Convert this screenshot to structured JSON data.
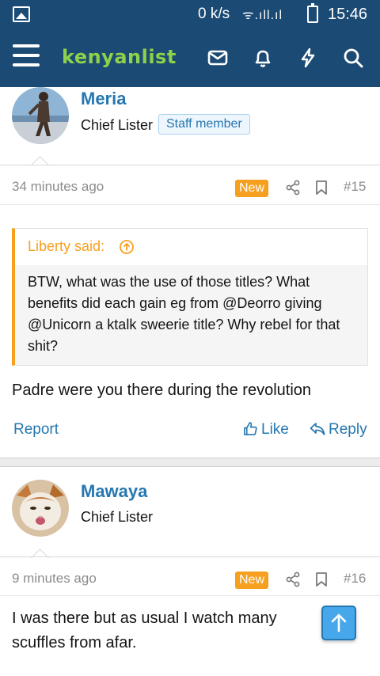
{
  "status_bar": {
    "speed": "0 k/s",
    "signal": "ᯤ.ıll.ıl",
    "time": "15:46"
  },
  "app_bar": {
    "logo_text": "kenyanlist",
    "icons": [
      "menu-icon",
      "inbox-icon",
      "bell-icon",
      "bolt-icon",
      "search-icon"
    ]
  },
  "colors": {
    "brand_bar": "#1b4a75",
    "link": "#2577b1",
    "logo_green": "#8ed14a",
    "new_badge": "#f79f1f",
    "quote_border": "#f79f1f"
  },
  "posts": [
    {
      "username": "Meria",
      "user_title": "Chief Lister",
      "badge": "Staff member",
      "time": "34 minutes ago",
      "new_label": "New",
      "number": "#15",
      "quote": {
        "attribution": "Liberty said:",
        "text": "BTW, what was the use of those titles? What benefits did each gain eg from @Deorro giving @Unicorn a ktalk sweerie title? Why rebel for that shit?"
      },
      "body": "Padre were you there during the revolution",
      "actions": {
        "report": "Report",
        "like": "Like",
        "reply": "Reply"
      }
    },
    {
      "username": "Mawaya",
      "user_title": "Chief Lister",
      "time": "9 minutes ago",
      "new_label": "New",
      "number": "#16",
      "body": "I was there but as usual I watch many scuffles from afar."
    }
  ]
}
